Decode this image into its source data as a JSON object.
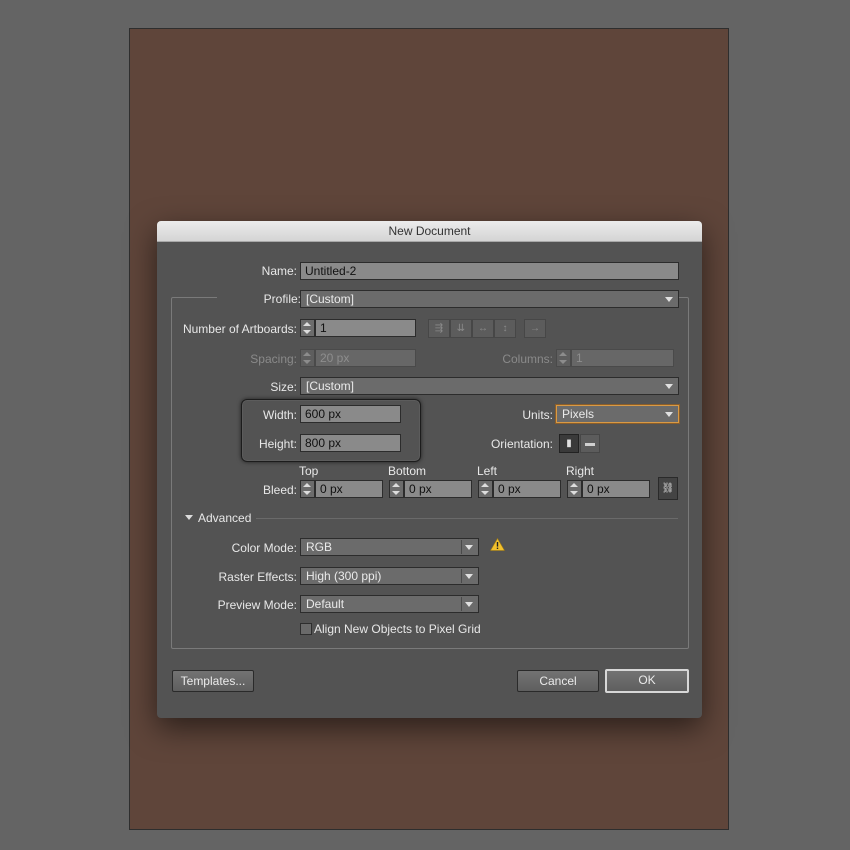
{
  "dialog": {
    "title": "New Document"
  },
  "name": {
    "label": "Name:",
    "value": "Untitled-2"
  },
  "profile": {
    "label": "Profile:",
    "value": "[Custom]"
  },
  "artboards": {
    "label": "Number of Artboards:",
    "value": "1"
  },
  "spacing": {
    "label": "Spacing:",
    "value": "20 px"
  },
  "columns": {
    "label": "Columns:",
    "value": "1"
  },
  "size": {
    "label": "Size:",
    "value": "[Custom]"
  },
  "width": {
    "label": "Width:",
    "value": "600 px"
  },
  "height": {
    "label": "Height:",
    "value": "800 px"
  },
  "units": {
    "label": "Units:",
    "value": "Pixels"
  },
  "orientation": {
    "label": "Orientation:"
  },
  "bleed": {
    "label": "Bleed:",
    "top": {
      "header": "Top",
      "value": "0 px"
    },
    "bottom": {
      "header": "Bottom",
      "value": "0 px"
    },
    "left": {
      "header": "Left",
      "value": "0 px"
    },
    "right": {
      "header": "Right",
      "value": "0 px"
    }
  },
  "advanced": {
    "label": "Advanced"
  },
  "color_mode": {
    "label": "Color Mode:",
    "value": "RGB"
  },
  "raster_effects": {
    "label": "Raster Effects:",
    "value": "High (300 ppi)"
  },
  "preview_mode": {
    "label": "Preview Mode:",
    "value": "Default"
  },
  "pixel_grid": {
    "label": "Align New Objects to Pixel Grid",
    "checked": false
  },
  "buttons": {
    "templates": "Templates...",
    "cancel": "Cancel",
    "ok": "OK"
  },
  "colors": {
    "artboard": "#5f453a",
    "dialog": "#535353",
    "warning": "#f2c12e",
    "focus": "#d99a45"
  }
}
